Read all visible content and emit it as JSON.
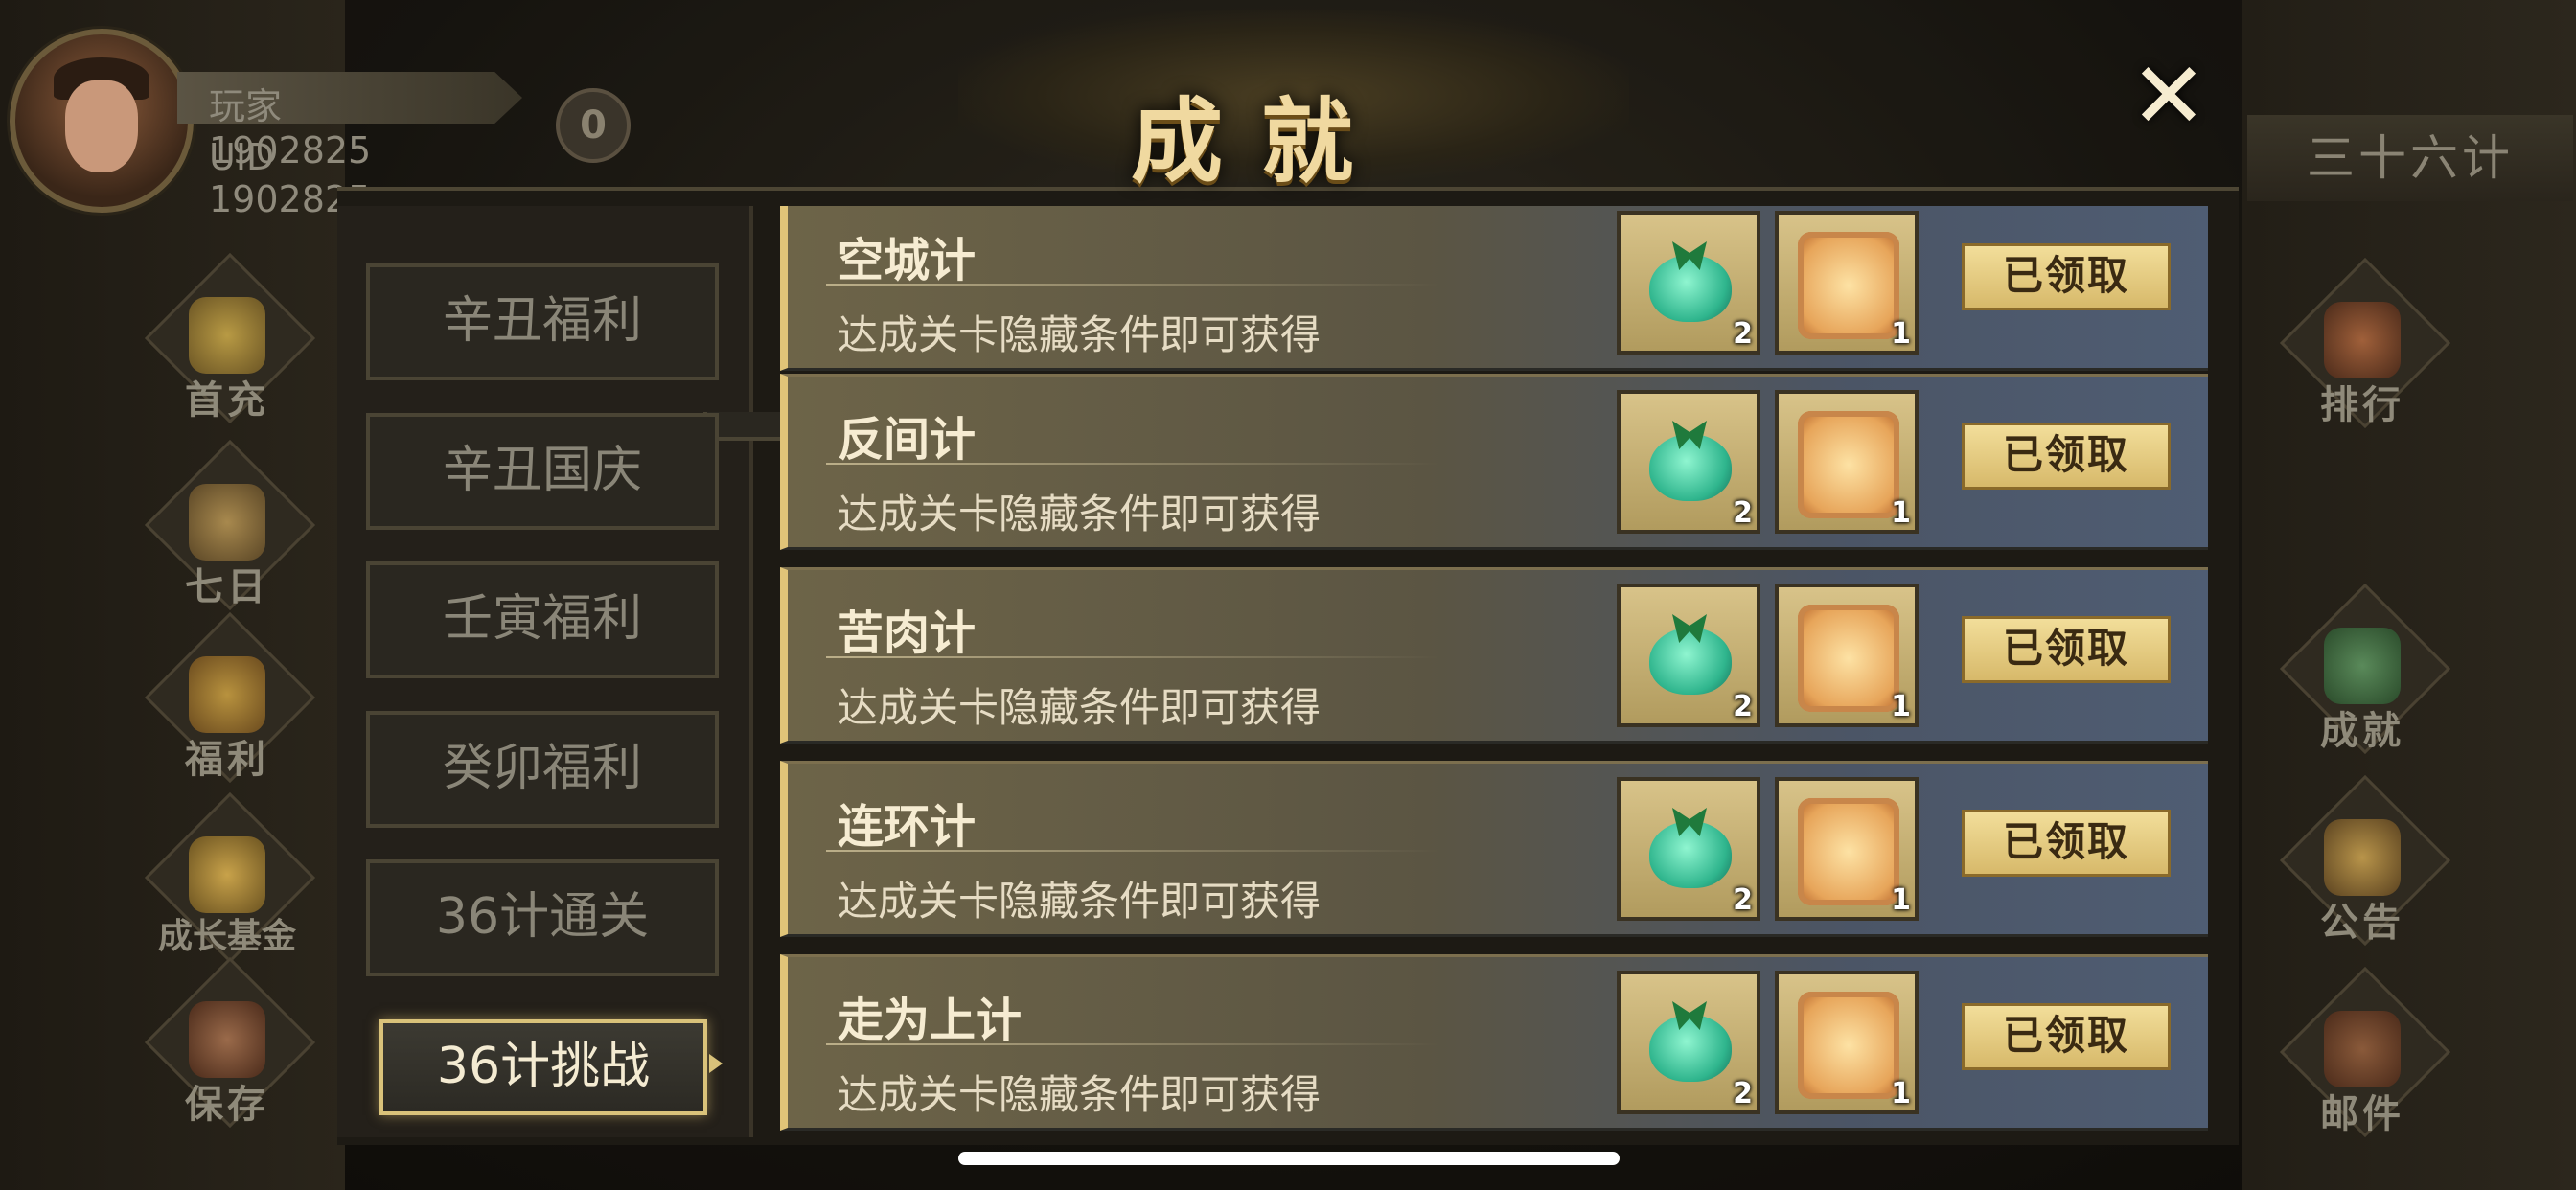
{
  "player": {
    "name": "玩家1902825",
    "uid": "UID  1902825",
    "coin": "0"
  },
  "left_menu": [
    {
      "label": "首充",
      "icon": "gold-coins-icon"
    },
    {
      "label": "七日",
      "icon": "scroll-seven-icon"
    },
    {
      "label": "福利",
      "icon": "treasure-chest-icon"
    },
    {
      "label": "成长基金",
      "icon": "gold-pile-icon"
    },
    {
      "label": "保存",
      "icon": "save-scroll-icon"
    }
  ],
  "right_menu": {
    "stratagem_title": "三十六计",
    "items": [
      {
        "label": "排行",
        "icon": "ranking-pavilion-icon"
      },
      {
        "label": "成就",
        "icon": "jade-achievement-icon"
      },
      {
        "label": "公告",
        "icon": "horn-icon"
      },
      {
        "label": "邮件",
        "icon": "mail-box-icon"
      }
    ]
  },
  "modal": {
    "title": "成就",
    "close": "✕",
    "tabs": [
      {
        "label": "辛丑福利"
      },
      {
        "label": "辛丑国庆"
      },
      {
        "label": "壬寅福利"
      },
      {
        "label": "癸卯福利"
      },
      {
        "label": "36计通关"
      },
      {
        "label": "36计挑战"
      }
    ],
    "active_tab": "36计挑战",
    "achievements": [
      {
        "name": "空城计",
        "desc": "达成关卡隐藏条件即可获得",
        "reward1_count": "2",
        "reward2_count": "1",
        "button": "已领取"
      },
      {
        "name": "反间计",
        "desc": "达成关卡隐藏条件即可获得",
        "reward1_count": "2",
        "reward2_count": "1",
        "button": "已领取"
      },
      {
        "name": "苦肉计",
        "desc": "达成关卡隐藏条件即可获得",
        "reward1_count": "2",
        "reward2_count": "1",
        "button": "已领取"
      },
      {
        "name": "连环计",
        "desc": "达成关卡隐藏条件即可获得",
        "reward1_count": "2",
        "reward2_count": "1",
        "button": "已领取"
      },
      {
        "name": "走为上计",
        "desc": "达成关卡隐藏条件即可获得",
        "reward1_count": "2",
        "reward2_count": "1",
        "button": "已领取"
      }
    ]
  },
  "colors": {
    "accent_gold": "#e0c478",
    "row_blue": "#4f5d73",
    "button_gold": "#f2de9a"
  }
}
